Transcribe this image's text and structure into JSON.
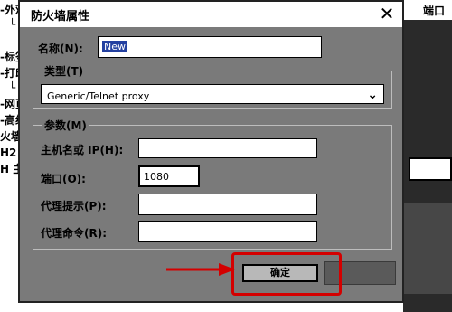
{
  "background": {
    "tree": [
      {
        "prefix": "-",
        "text": "外观"
      },
      {
        "prefix": "└",
        "text": ""
      },
      {
        "prefix": "-",
        "text": "标签"
      },
      {
        "prefix": "-",
        "text": "打印"
      },
      {
        "prefix": "└",
        "text": ""
      },
      {
        "prefix": "-",
        "text": "网页"
      },
      {
        "prefix": "-",
        "text": "高级"
      },
      {
        "prefix": "",
        "text": "火墙"
      },
      {
        "prefix": "",
        "text": "H2"
      },
      {
        "prefix": "",
        "text": "H 主机"
      }
    ],
    "right_label": "端口"
  },
  "dialog": {
    "title": "防火墙属性",
    "close_icon": "close-icon",
    "name_label": "名称(N):",
    "name_value": "New",
    "type_group_title": "类型(T)",
    "type_value": "Generic/Telnet proxy",
    "params_group_title": "参数(M)",
    "host_label": "主机名或 IP(H):",
    "host_value": "",
    "port_label": "端口(O):",
    "port_value": "1080",
    "proxy_prompt_label": "代理提示(P):",
    "proxy_prompt_value": "",
    "proxy_command_label": "代理命令(R):",
    "proxy_command_value": "",
    "ok_label": "确定"
  },
  "colors": {
    "dialog_bg": "#7a7a7a",
    "highlight": "#d40000",
    "selection": "#2340a0"
  }
}
